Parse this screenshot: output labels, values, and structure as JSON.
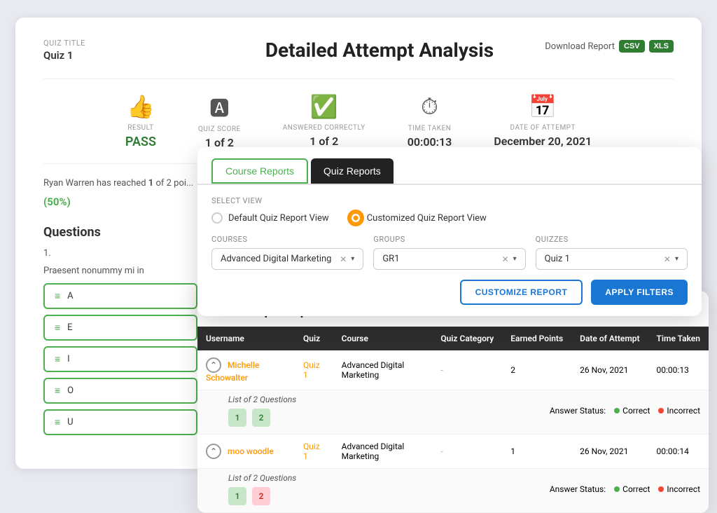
{
  "page": {
    "title": "Detailed Attempt Analysis",
    "download_label": "Download Report"
  },
  "quiz": {
    "title_label": "QUIZ TITLE",
    "title_value": "Quiz 1"
  },
  "stats": [
    {
      "icon": "👍",
      "label": "RESULT",
      "value": "PASS",
      "type": "pass"
    },
    {
      "icon": "🅰",
      "label": "QUIZ SCORE",
      "value": "1 of 2"
    },
    {
      "icon": "✅",
      "label": "ANSWERED CORRECTLY",
      "value": "1 of 2"
    },
    {
      "icon": "⏱",
      "label": "TIME TAKEN",
      "value": "00:00:13"
    },
    {
      "icon": "📅",
      "label": "DATE OF ATTEMPT",
      "value": "December 20, 2021"
    }
  ],
  "questions": {
    "title": "Questions",
    "number": "1.",
    "text": "Praesent nonummy mi in",
    "options": [
      "A",
      "E",
      "I",
      "O",
      "U"
    ]
  },
  "tabs": {
    "course_reports": "Course Reports",
    "quiz_reports": "Quiz Reports"
  },
  "select_view": {
    "label": "SELECT VIEW",
    "default_label": "Default Quiz Report View",
    "custom_label": "Customized Quiz Report View"
  },
  "filters": {
    "courses_label": "COURSES",
    "courses_value": "Advanced Digital Marketing",
    "groups_label": "GROUPS",
    "groups_value": "GR1",
    "quizzes_label": "QUIZZES",
    "quizzes_value": "Quiz 1"
  },
  "buttons": {
    "customize": "CUSTOMIZE REPORT",
    "apply": "APPLY FILTERS"
  },
  "attempts_report": {
    "title": "All Attempts Report",
    "columns": [
      "Username",
      "Quiz",
      "Course",
      "Quiz Category",
      "Earned Points",
      "Date of Attempt",
      "Time Taken"
    ],
    "rows": [
      {
        "username": "Michelle Schowalter",
        "quiz": "Quiz 1",
        "course": "Advanced Digital Marketing",
        "category": "-",
        "earned_points": "2",
        "date": "26 Nov, 2021",
        "time": "00:00:13",
        "questions_label": "List of 2 Questions",
        "answers": [
          {
            "num": "1",
            "type": "correct"
          },
          {
            "num": "2",
            "type": "correct"
          }
        ]
      },
      {
        "username": "moo woodle",
        "quiz": "Quiz 1",
        "course": "Advanced Digital Marketing",
        "category": "-",
        "earned_points": "1",
        "date": "26 Nov, 2021",
        "time": "00:00:14",
        "questions_label": "List of 2 Questions",
        "answers": [
          {
            "num": "1",
            "type": "correct"
          },
          {
            "num": "2",
            "type": "incorrect"
          }
        ]
      }
    ],
    "answer_status_label": "Answer Status:",
    "correct_label": "Correct",
    "incorrect_label": "Incorrect"
  },
  "colors": {
    "accent_orange": "#ff9800",
    "accent_green": "#4caf50",
    "accent_blue": "#1976d2",
    "tab_active": "#222222"
  }
}
